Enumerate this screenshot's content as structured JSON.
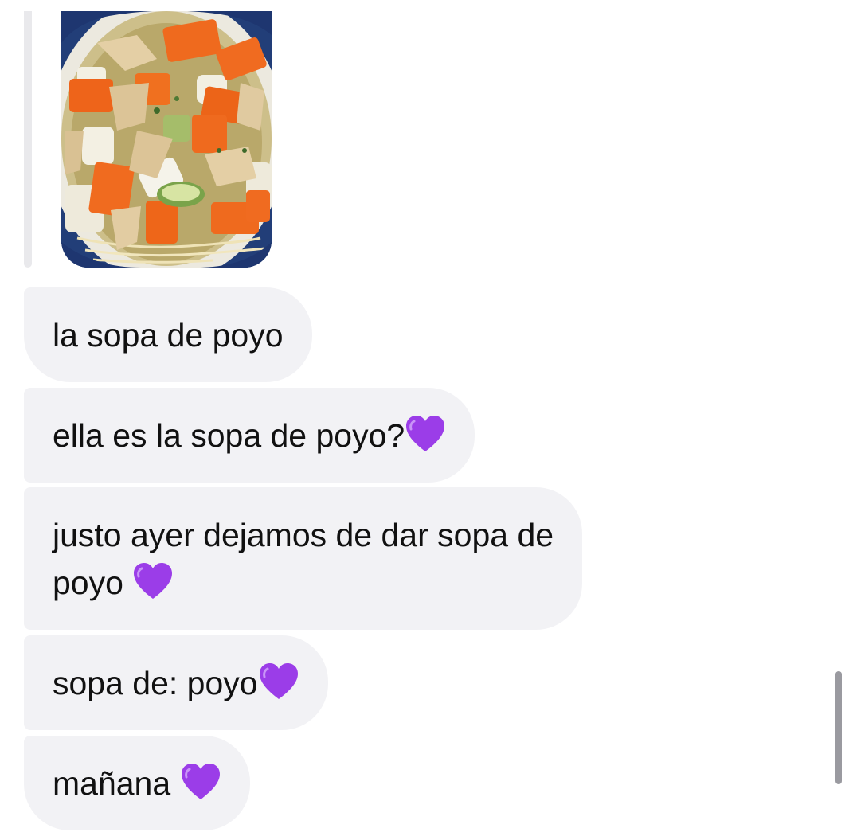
{
  "thread": {
    "image": {
      "description_icon": "photo-thumbnail",
      "background_color": "#1f3a72"
    },
    "messages": [
      {
        "text": "la sopa de poyo",
        "emoji": ""
      },
      {
        "text": "ella es la sopa de poyo?",
        "emoji": "purple-heart"
      },
      {
        "text": "justo ayer dejamos de dar sopa de",
        "text_line2": "poyo ",
        "emoji": "purple-heart"
      },
      {
        "text": "sopa de: poyo",
        "emoji": "purple-heart"
      },
      {
        "text": "mañana ",
        "emoji": "purple-heart"
      }
    ]
  },
  "colors": {
    "bubble_background": "#f2f2f5",
    "text": "#111111",
    "heart": "#9b3de8"
  }
}
